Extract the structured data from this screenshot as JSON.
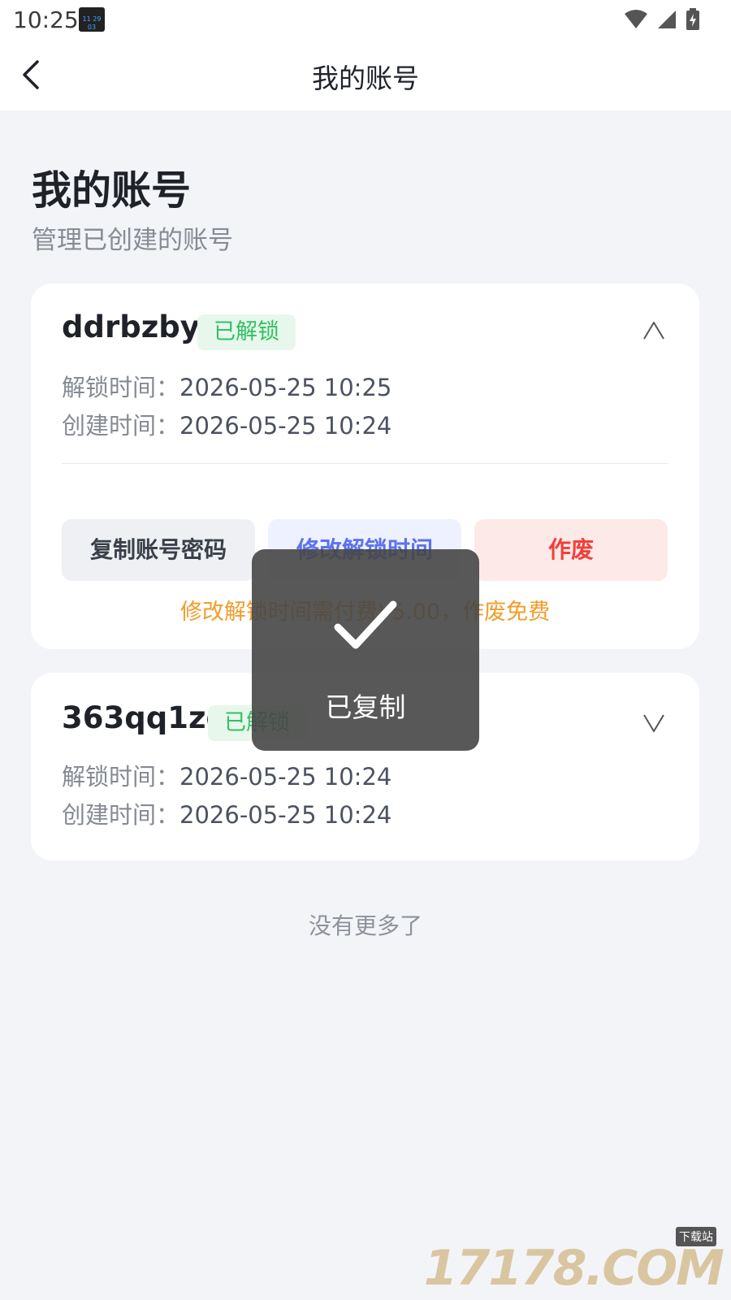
{
  "status_bar": {
    "time": "10:25",
    "app_icon_text": "11 29 03"
  },
  "top_bar": {
    "title": "我的账号"
  },
  "header": {
    "title": "我的账号",
    "subtitle": "管理已创建的账号"
  },
  "accounts": [
    {
      "name": "ddrbzbya",
      "status": "已解锁",
      "unlock_label": "解锁时间：",
      "unlock_time": "2026-05-25 10:25",
      "created_label": "创建时间：",
      "created_time": "2026-05-25 10:24",
      "expanded": true,
      "buttons": {
        "copy": "复制账号密码",
        "modify": "修改解锁时间",
        "void": "作废"
      },
      "fee_note": "修改解锁时间需付费¥5.00，作废免费"
    },
    {
      "name": "363qq1ze",
      "status": "已解锁",
      "unlock_label": "解锁时间：",
      "unlock_time": "2026-05-25 10:24",
      "created_label": "创建时间：",
      "created_time": "2026-05-25 10:24",
      "expanded": false
    }
  ],
  "footer": {
    "no_more": "没有更多了"
  },
  "toast": {
    "message": "已复制"
  },
  "watermark": {
    "text": "17178.COM",
    "tag": "下载站"
  },
  "colors": {
    "background": "#f3f4f8",
    "unlocked_badge": "#33c063",
    "modify_button": "#5b72f0",
    "void_button": "#f0413a",
    "fee_note": "#f29c2b"
  }
}
